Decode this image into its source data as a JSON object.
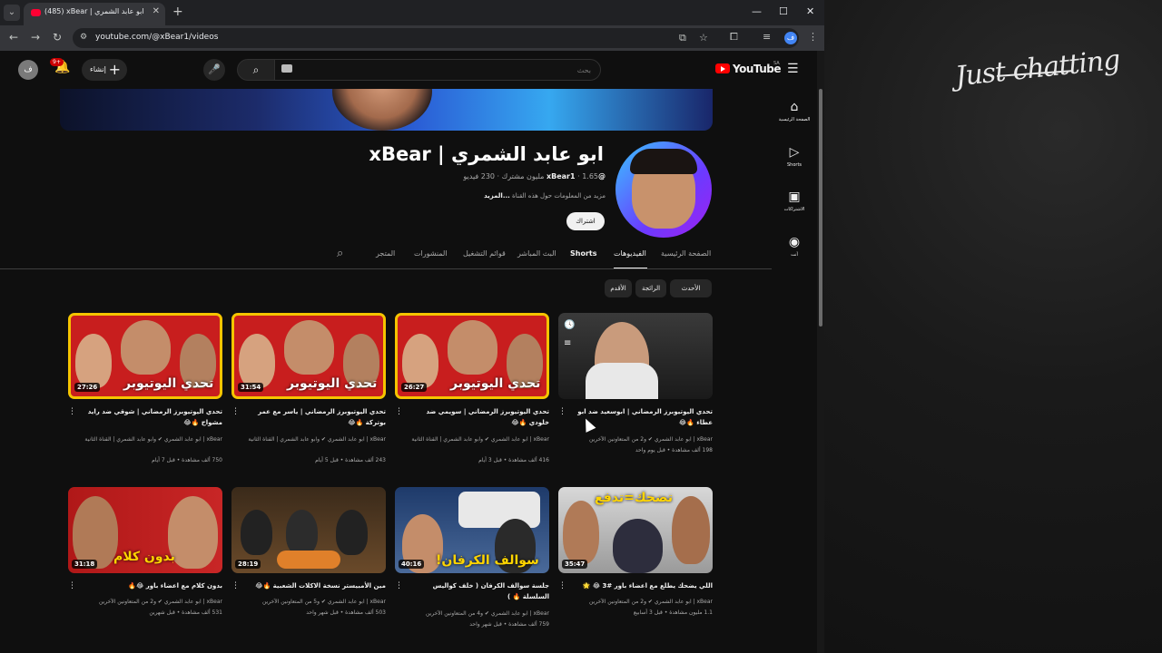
{
  "browser": {
    "tab_title": "(485) xBear | ابو عابد الشمري - Yo",
    "url": "youtube.com/@xBear1/videos"
  },
  "yt_header": {
    "avatar_letter": "ف",
    "notification_count": "9+",
    "create_label": "إنشاء",
    "search_placeholder": "بحث",
    "logo_text": "YouTube",
    "region": "SA"
  },
  "guide": [
    {
      "icon": "home-icon",
      "label": "الصفحة الرئيسية"
    },
    {
      "icon": "shorts-icon",
      "label": "Shorts"
    },
    {
      "icon": "subscriptions-icon",
      "label": "الاشتراكات"
    },
    {
      "icon": "you-icon",
      "label": "أنت"
    }
  ],
  "channel": {
    "name": "ابو عابد الشمري | xBear",
    "handle": "@xBear1",
    "subscribers": "1.65 مليون مشترك",
    "videos_count": "230 فيديو",
    "about_text": "مزيد من المعلومات حول هذه القناة",
    "about_more": "...المزيد",
    "subscribe_label": "اشتراك"
  },
  "channel_tabs": [
    {
      "label": "الصفحة الرئيسية",
      "active": false
    },
    {
      "label": "الفيديوهات",
      "active": true
    },
    {
      "label": "Shorts",
      "active": false
    },
    {
      "label": "البث المباشر",
      "active": false
    },
    {
      "label": "قوائم التشغيل",
      "active": false
    },
    {
      "label": "المنشورات",
      "active": false
    },
    {
      "label": "المتجر",
      "active": false
    }
  ],
  "sort_chips": [
    "الأحدث",
    "الرائجة",
    "الأقدم"
  ],
  "videos": [
    {
      "title": "تحدي اليوتيوبرز الرمضاني | ابوسعيد ضد ابو عطاء 🔥😂",
      "channel": "xBear | ابو عابد الشمري ✔ و2 من المتعاونين الآخرين",
      "stats": "198 ألف مشاهدة • قبل يوم واحد",
      "duration": "",
      "thumb_text": ""
    },
    {
      "title": "تحدي اليوتيوبرز الرمضاني | سويمي ضد خلودي 🔥😂",
      "channel": "xBear | ابو عابد الشمري ✔ وابو عابد الشمري | القناة الثانية",
      "stats": "416 ألف مشاهدة • قبل 3 أيام",
      "duration": "26:27",
      "thumb_text": "تحدي اليوتيوبر"
    },
    {
      "title": "تحدي اليوتيوبرز الرمضاني | ياسر مع عمر بوتركة 🔥😂",
      "channel": "xBear | ابو عابد الشمري ✔ وابو عابد الشمري | القناة الثانية",
      "stats": "243 ألف مشاهدة • قبل 5 أيام",
      "duration": "31:54",
      "thumb_text": "تحدي اليوتيوبر"
    },
    {
      "title": "تحدي اليوتيوبرز الرمضاني | شوقي ضد رايد مشواح 🔥😂",
      "channel": "xBear | ابو عابد الشمري ✔ وابو عابد الشمري | القناة الثانية",
      "stats": "750 ألف مشاهدة • قبل 7 أيام",
      "duration": "27:26",
      "thumb_text": "تحدي اليوتيوبر"
    },
    {
      "title": "اللي يضحك يطلع مع اعضاء باور #3 😂 🌟",
      "channel": "xBear | ابو عابد الشمري ✔ و2 من المتعاونين الآخرين",
      "stats": "1.1 مليون مشاهدة • قبل 3 أسابيع",
      "duration": "35:47",
      "thumb_text": "تضحك=تدفع"
    },
    {
      "title": "جلسة سوالف الكرفان ( خلف كواليس السلسلة 🔥 )",
      "channel": "xBear | ابو عابد الشمري ✔ و4 من المتعاونين الآخرين",
      "stats": "759 ألف مشاهدة • قبل شهر واحد",
      "duration": "40:16",
      "thumb_text": "سوالف الكرفان!"
    },
    {
      "title": "مين الأمبيستر نسخة الاكلات الشعبية 🔥😂",
      "channel": "xBear | ابو عابد الشمري ✔ و5 من المتعاونين الآخرين",
      "stats": "503 ألف مشاهدة • قبل شهر واحد",
      "duration": "28:19",
      "thumb_text": ""
    },
    {
      "title": "بدون كلام مع اعضاء باور 😂🔥",
      "channel": "xBear | ابو عابد الشمري ✔ و2 من المتعاونين الآخرين",
      "stats": "531 ألف مشاهدة • قبل شهرين",
      "duration": "31:18",
      "thumb_text": "بدون كلام"
    }
  ],
  "overlay": {
    "caption": "Just chatting"
  },
  "colors": {
    "accent": "#ff0000",
    "background": "#0f0f0f",
    "thumb_frame": "#f5c400"
  }
}
